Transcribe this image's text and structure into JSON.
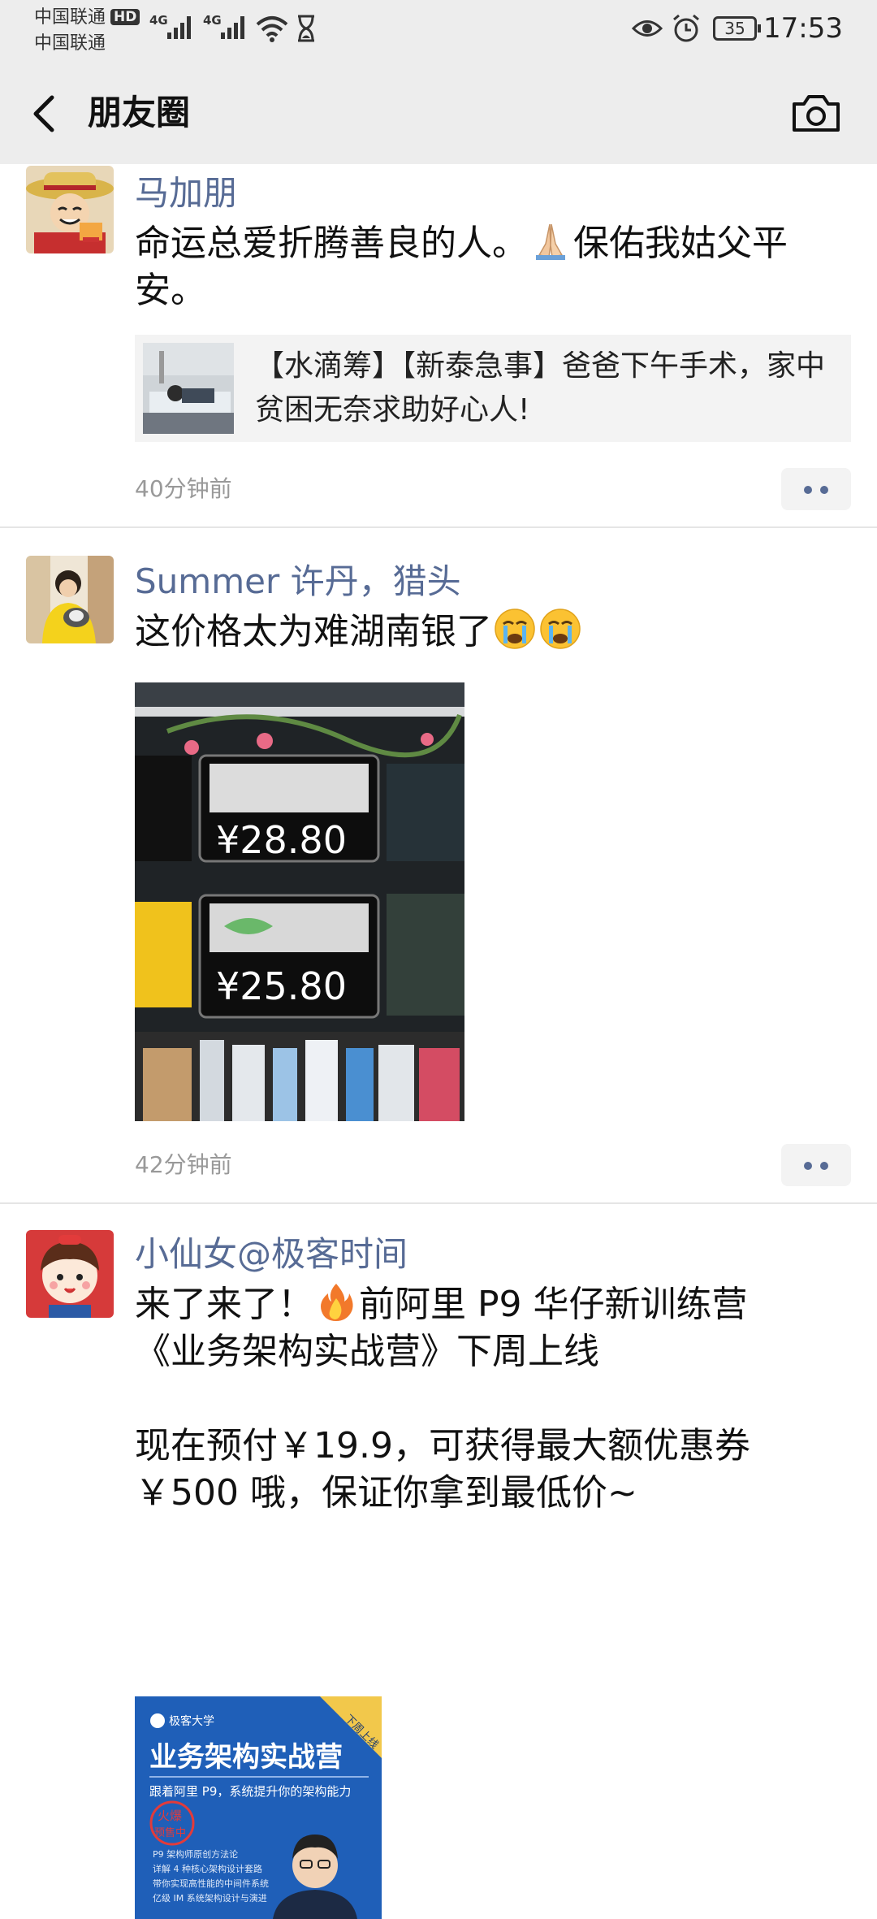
{
  "status_bar": {
    "carrier_1": "中国联通",
    "carrier_1_badge": "HD",
    "carrier_2": "中国联通",
    "network_1": "4G",
    "network_2": "4G",
    "battery_level": "35",
    "time": "17:53"
  },
  "header": {
    "title": "朋友圈",
    "back_icon": "back-arrow-icon",
    "camera_icon": "camera-icon"
  },
  "posts": [
    {
      "author": "马加朋",
      "text_part1": "命运总爱折腾善良的人。",
      "text_part2": "保佑我姑父平安。",
      "emoji": "folded-hands-emoji",
      "link_text": "【水滴筹】【新泰急事】爸爸下午手术，家中贫困无奈求助好心人!",
      "time": "40分钟前"
    },
    {
      "author": "Summer 许丹，猎头",
      "text": "这价格太为难湖南银了",
      "emoji": "crying-face-emoji",
      "photo_price_1": "¥28.80",
      "photo_price_2": "¥25.80",
      "time": "42分钟前"
    },
    {
      "author": "小仙女@极客时间",
      "text_line1_a": "来了来了！",
      "text_line1_b": "前阿里 P9 华仔新训练营",
      "text_line2": "《业务架构实战营》下周上线",
      "text_line3": "现在预付￥19.9，可获得最大额优惠券",
      "text_line4": "￥500 哦，保证你拿到最低价~",
      "emoji": "fire-emoji",
      "poster": {
        "brand": "极客大学",
        "corner_tag": "下周上线",
        "title": "业务架构实战营",
        "subtitle": "跟着阿里 P9，系统提升你的架构能力",
        "stamp_1": "火爆",
        "stamp_2": "预售中",
        "bullets": [
          "P9 架构师原创方法论",
          "详解 4 种核心架构设计套路",
          "带你实现高性能的中间件系统",
          "亿级 IM 系统架构设计与演进"
        ]
      }
    }
  ],
  "colors": {
    "name_blue": "#576b95",
    "header_bg": "#ededed",
    "card_bg": "#f3f3f3",
    "poster_blue": "#1f5fb8"
  }
}
